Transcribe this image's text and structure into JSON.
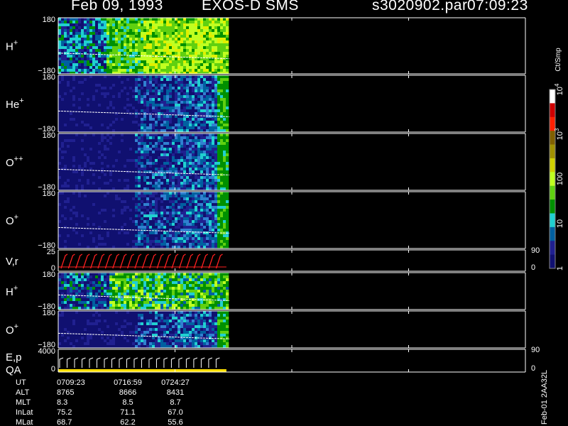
{
  "header": {
    "date": "Feb 09, 1993",
    "instrument": "EXOS-D SMS",
    "file": "s3020902.par",
    "time": "07:09:23"
  },
  "chart_data": {
    "type": "heatmap",
    "panels": [
      {
        "label": "H",
        "sup": "+",
        "ytop": "180",
        "ybot": "−180",
        "scheme": "H"
      },
      {
        "label": "He",
        "sup": "+",
        "ytop": "180",
        "ybot": "−180",
        "scheme": "He"
      },
      {
        "label": "O",
        "sup": "++",
        "ytop": "180",
        "ybot": "−180",
        "scheme": "O2"
      },
      {
        "label": "O",
        "sup": "+",
        "ytop": "180",
        "ybot": "−180",
        "scheme": "O1"
      },
      {
        "label": "V,r",
        "sup": "",
        "ytop": "25",
        "ybot": "0",
        "scheme": "V",
        "rightTop": "90",
        "rightBot": "0"
      },
      {
        "label": "H",
        "sup": "+",
        "ytop": "180",
        "ybot": "−180",
        "scheme": "H2"
      },
      {
        "label": "O",
        "sup": "+",
        "ytop": "180",
        "ybot": "−180",
        "scheme": "O3"
      },
      {
        "label": "E,p",
        "label2": "QA",
        "sup": "",
        "ytop": "4000",
        "ybot": "0",
        "scheme": "E",
        "rightTop": "90",
        "rightBot": "0"
      }
    ],
    "colorbar": {
      "unit": "Ct/Smp",
      "ticks": [
        {
          "value": 10000,
          "label": "10",
          "sup": "4"
        },
        {
          "value": 1000,
          "label": "10",
          "sup": "3"
        },
        {
          "value": 100,
          "label": "100",
          "sup": ""
        },
        {
          "value": 10,
          "label": "10",
          "sup": ""
        },
        {
          "value": 1,
          "label": "1",
          "sup": ""
        }
      ],
      "range": [
        1,
        10000
      ],
      "colors": [
        "#ffffff",
        "#d00000",
        "#ff2000",
        "#806000",
        "#a09000",
        "#d0d000",
        "#c0ff20",
        "#60d010",
        "#009000",
        "#20d0d0",
        "#0060a0",
        "#202090",
        "#101070"
      ]
    },
    "data_extent_fraction": 0.36
  },
  "footer": {
    "row_labels": [
      "UT",
      "ALT",
      "MLT",
      "InLat",
      "MLat"
    ],
    "columns": [
      [
        "0709:23",
        "8765",
        "8.3",
        "75.2",
        "68.7"
      ],
      [
        "0716:59",
        "8666",
        "8.5",
        "71.1",
        "62.2"
      ],
      [
        "0724:27",
        "8431",
        "8.7",
        "67.0",
        "55.6"
      ]
    ],
    "stamp": "Feb-01 2AA32L"
  }
}
